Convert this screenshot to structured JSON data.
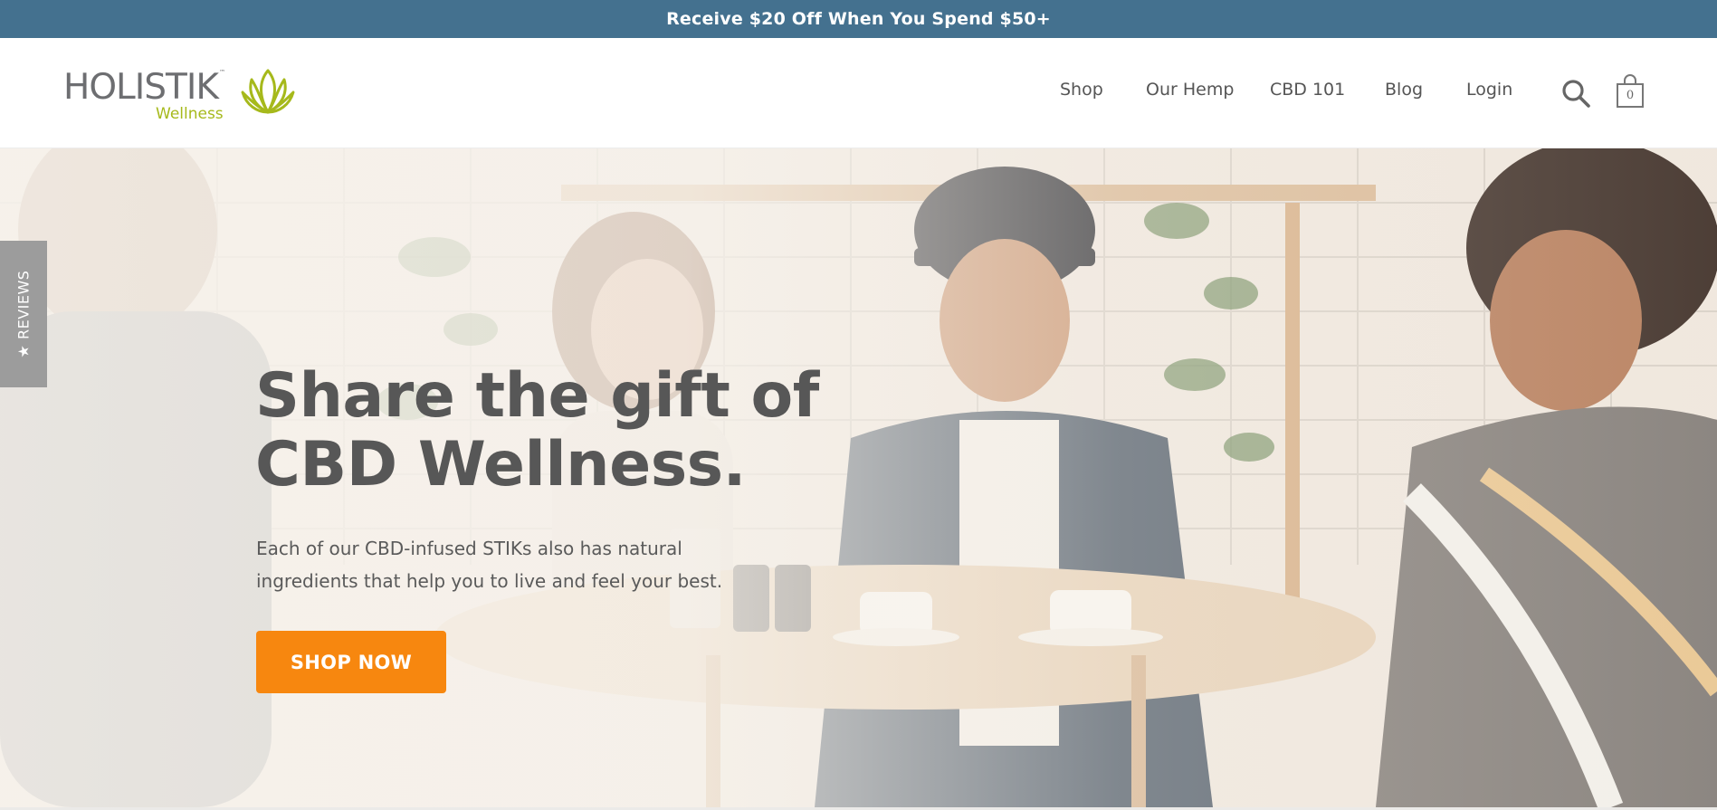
{
  "announcement": {
    "text": "Receive $20 Off When You Spend $50+"
  },
  "brand": {
    "name": "HOLISTIK",
    "tm": "™",
    "tagline": "Wellness",
    "colors": {
      "gray": "#6d6e71",
      "green": "#a6b91b"
    }
  },
  "nav": {
    "items": [
      "Shop",
      "Our Hemp",
      "CBD 101",
      "Blog",
      "Login"
    ],
    "cart_count": "0",
    "icons": [
      "search-icon",
      "shopping-bag-icon"
    ]
  },
  "hero": {
    "title_line1": "Share the gift of",
    "title_line2": "CBD Wellness.",
    "subtitle_line1": "Each of our CBD-infused STIKs also has natural",
    "subtitle_line2": "ingredients that help you to live and feel your best.",
    "cta": "SHOP NOW",
    "cta_color": "#f7870f"
  },
  "reviews_tab": {
    "label": "★ REVIEWS"
  },
  "colors": {
    "announcement_bg": "#44718f",
    "text": "#575757"
  }
}
